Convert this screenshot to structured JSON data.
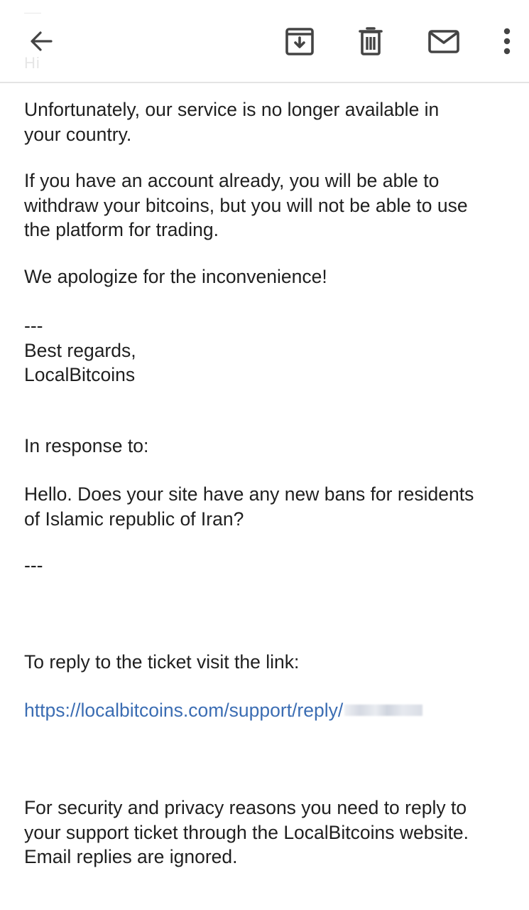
{
  "toolbar": {
    "ghost_title": "Hi",
    "back_icon": "arrow-left-icon",
    "archive_icon": "archive-icon",
    "delete_icon": "trash-icon",
    "mail_icon": "mail-icon",
    "more_icon": "more-vertical-icon",
    "icon_color": "#444444"
  },
  "email": {
    "body": [
      "Unfortunately, our service is no longer available in\nyour country.",
      "If you have an account already, you will be able to\nwithdraw your bitcoins, but you will not be able to use\nthe platform for trading.",
      "We apologize for the inconvenience!",
      "---\nBest regards,\nLocalBitcoins",
      "In response to:",
      "Hello. Does your site have any new bans for residents\nof Islamic republic of Iran?",
      "---",
      "To reply to the ticket visit the link:",
      "For security and privacy reasons you need to reply to\nyour support ticket through the LocalBitcoins website.\nEmail replies are ignored."
    ],
    "link": "https://localbitcoins.com/support/reply/",
    "link_color": "#3b6db3"
  }
}
